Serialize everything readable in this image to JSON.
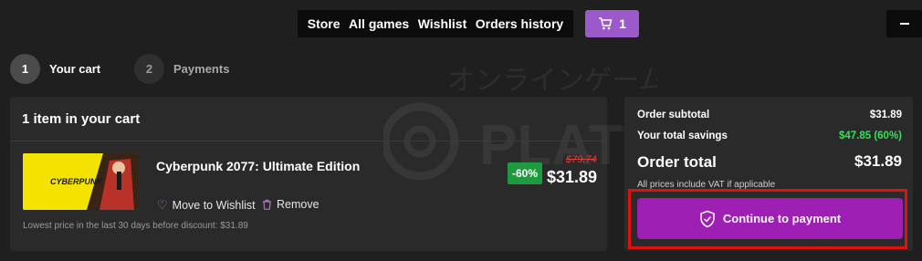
{
  "nav": {
    "items": [
      "Store",
      "All games",
      "Wishlist",
      "Orders history"
    ],
    "cart_count": "1"
  },
  "steps": [
    {
      "number": "1",
      "label": "Your cart"
    },
    {
      "number": "2",
      "label": "Payments"
    }
  ],
  "cart": {
    "heading": "1 item in your cart",
    "item": {
      "title": "Cyberpunk 2077: Ultimate Edition",
      "thumbnail_text": "CYBERPUNK",
      "discount": "-60%",
      "old_price": "$79.74",
      "price": "$31.89",
      "wishlist_label": "Move to Wishlist",
      "remove_label": "Remove",
      "lowest_price_note": "Lowest price in the last 30 days before discount: $31.89"
    }
  },
  "summary": {
    "subtotal_label": "Order subtotal",
    "subtotal_value": "$31.89",
    "savings_label": "Your total savings",
    "savings_value": "$47.85 (60%)",
    "total_label": "Order total",
    "total_value": "$31.89",
    "vat_note": "All prices include VAT if applicable",
    "pay_button": "Continue to payment"
  },
  "colors": {
    "background": "#1f1f1f",
    "panel": "#2a2a2a",
    "accent_purple": "#9e1fb3",
    "cart_button": "#9b59c9",
    "discount_green": "#1f9a3f",
    "savings_green": "#3ddc5c",
    "old_price_red": "#e23b3b",
    "highlight_red": "#e01010"
  },
  "watermark": "PLATT オンラインゲーム"
}
